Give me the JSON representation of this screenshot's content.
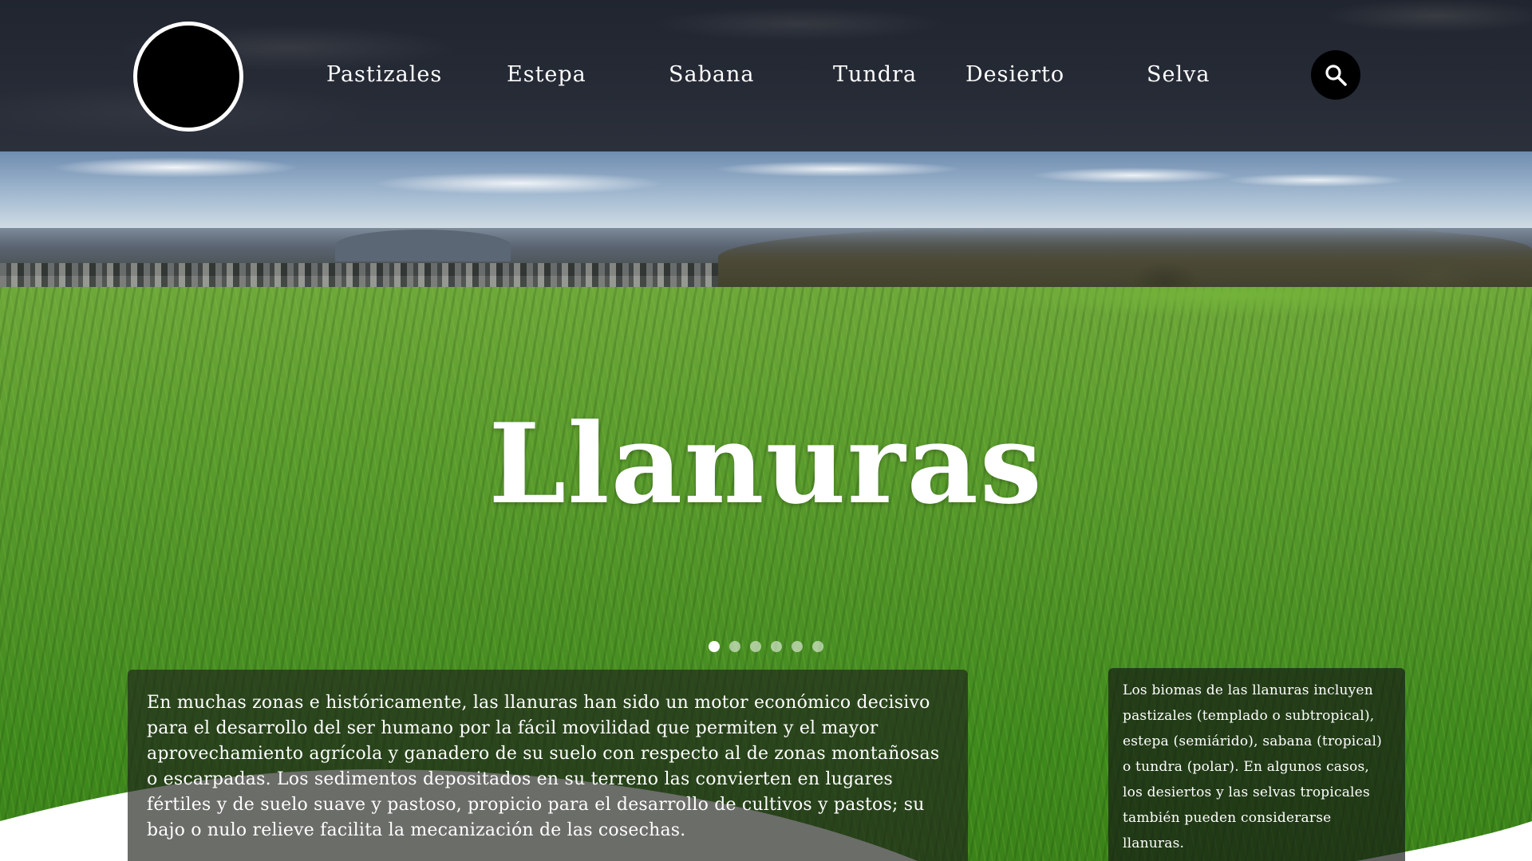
{
  "nav": {
    "items": [
      "Pastizales",
      "Estepa",
      "Sabana",
      "Tundra",
      "Desierto",
      "Selva"
    ]
  },
  "search": {
    "icon": "search-icon"
  },
  "logo": {
    "icon": "logo-circle"
  },
  "hero": {
    "title": "Llanuras",
    "carousel": {
      "total_slides": 6,
      "active_slide": 1
    }
  },
  "info_left": {
    "text": "En muchas zonas e históricamente, las llanuras han sido un motor económico decisivo para el desarrollo del ser humano por la fácil movilidad que permiten y el mayor aprovechamiento agrícola y ganadero de su suelo con respecto al de zonas montañosas o escarpadas. Los sedimentos depositados en su terreno las convierten en lugares fértiles y de suelo suave y pastoso, propicio para el desarrollo de cultivos y pastos; su bajo o nulo relieve facilita la mecanización de las cosechas."
  },
  "info_right": {
    "text": "Los biomas de las llanuras incluyen pastizales (templado o subtropical), estepa (semiárido), sabana (tropical) o tundra (polar). En algunos casos, los desiertos y las selvas tropicales también pueden considerarse llanuras."
  },
  "colors": {
    "header_bg": "#242933",
    "grass": "#4e9226",
    "text": "#ffffff",
    "panel_bg": "#1e221c"
  }
}
